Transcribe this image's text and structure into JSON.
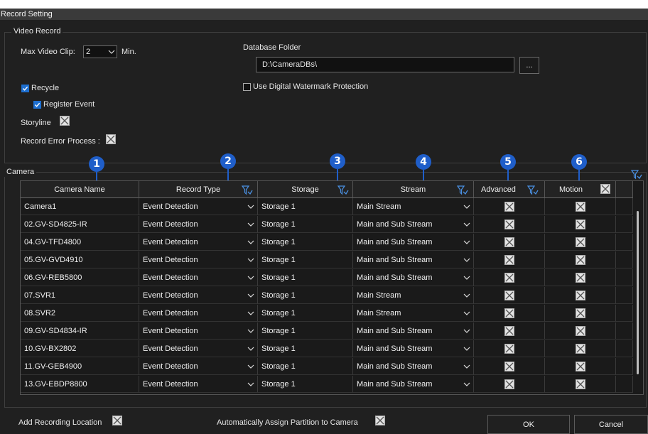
{
  "window": {
    "title": "Record Setting"
  },
  "video_record": {
    "legend": "Video Record",
    "max_video_clip_label": "Max Video Clip:",
    "max_video_clip_value": "2",
    "max_video_clip_unit": "Min.",
    "database_folder_label": "Database Folder",
    "database_folder_value": "D:\\CameraDBs\\",
    "browse_label": "...",
    "recycle_label": "Recycle",
    "recycle_checked": true,
    "register_event_label": "Register Event",
    "register_event_checked": true,
    "watermark_label": "Use Digital Watermark Protection",
    "watermark_checked": false,
    "storyline_label": "Storyline",
    "record_error_label": "Record Error Process :"
  },
  "camera": {
    "legend": "Camera",
    "columns": [
      "Camera Name",
      "Record Type",
      "Storage",
      "Stream",
      "Advanced",
      "Motion"
    ],
    "rows": [
      {
        "name": "Camera1",
        "record_type": "Event Detection",
        "storage": "Storage 1",
        "stream": "Main Stream"
      },
      {
        "name": "02.GV-SD4825-IR",
        "record_type": "Event Detection",
        "storage": "Storage 1",
        "stream": "Main and Sub Stream"
      },
      {
        "name": "04.GV-TFD4800",
        "record_type": "Event Detection",
        "storage": "Storage 1",
        "stream": "Main and Sub Stream"
      },
      {
        "name": "05.GV-GVD4910",
        "record_type": "Event Detection",
        "storage": "Storage 1",
        "stream": "Main and Sub Stream"
      },
      {
        "name": "06.GV-REB5800",
        "record_type": "Event Detection",
        "storage": "Storage 1",
        "stream": "Main and Sub Stream"
      },
      {
        "name": "07.SVR1",
        "record_type": "Event Detection",
        "storage": "Storage 1",
        "stream": "Main Stream"
      },
      {
        "name": "08.SVR2",
        "record_type": "Event Detection",
        "storage": "Storage 1",
        "stream": "Main Stream"
      },
      {
        "name": "09.GV-SD4834-IR",
        "record_type": "Event Detection",
        "storage": "Storage 1",
        "stream": "Main and Sub Stream"
      },
      {
        "name": "10.GV-BX2802",
        "record_type": "Event Detection",
        "storage": "Storage 1",
        "stream": "Main and Sub Stream"
      },
      {
        "name": "11.GV-GEB4900",
        "record_type": "Event Detection",
        "storage": "Storage 1",
        "stream": "Main and Sub Stream"
      },
      {
        "name": "13.GV-EBDP8800",
        "record_type": "Event Detection",
        "storage": "Storage 1",
        "stream": "Main and Sub Stream"
      }
    ],
    "markers": [
      "1",
      "2",
      "3",
      "4",
      "5",
      "6"
    ]
  },
  "footer": {
    "add_location_label": "Add Recording Location",
    "auto_assign_label": "Automatically Assign Partition to Camera",
    "ok_label": "OK",
    "cancel_label": "Cancel"
  },
  "colors": {
    "accent": "#1f5ec9",
    "background": "#202020",
    "checkbox": "#1e6fd0"
  },
  "icons": [
    "chevron-down-icon",
    "broken-image-icon",
    "sort-filter-icon",
    "check-icon"
  ]
}
